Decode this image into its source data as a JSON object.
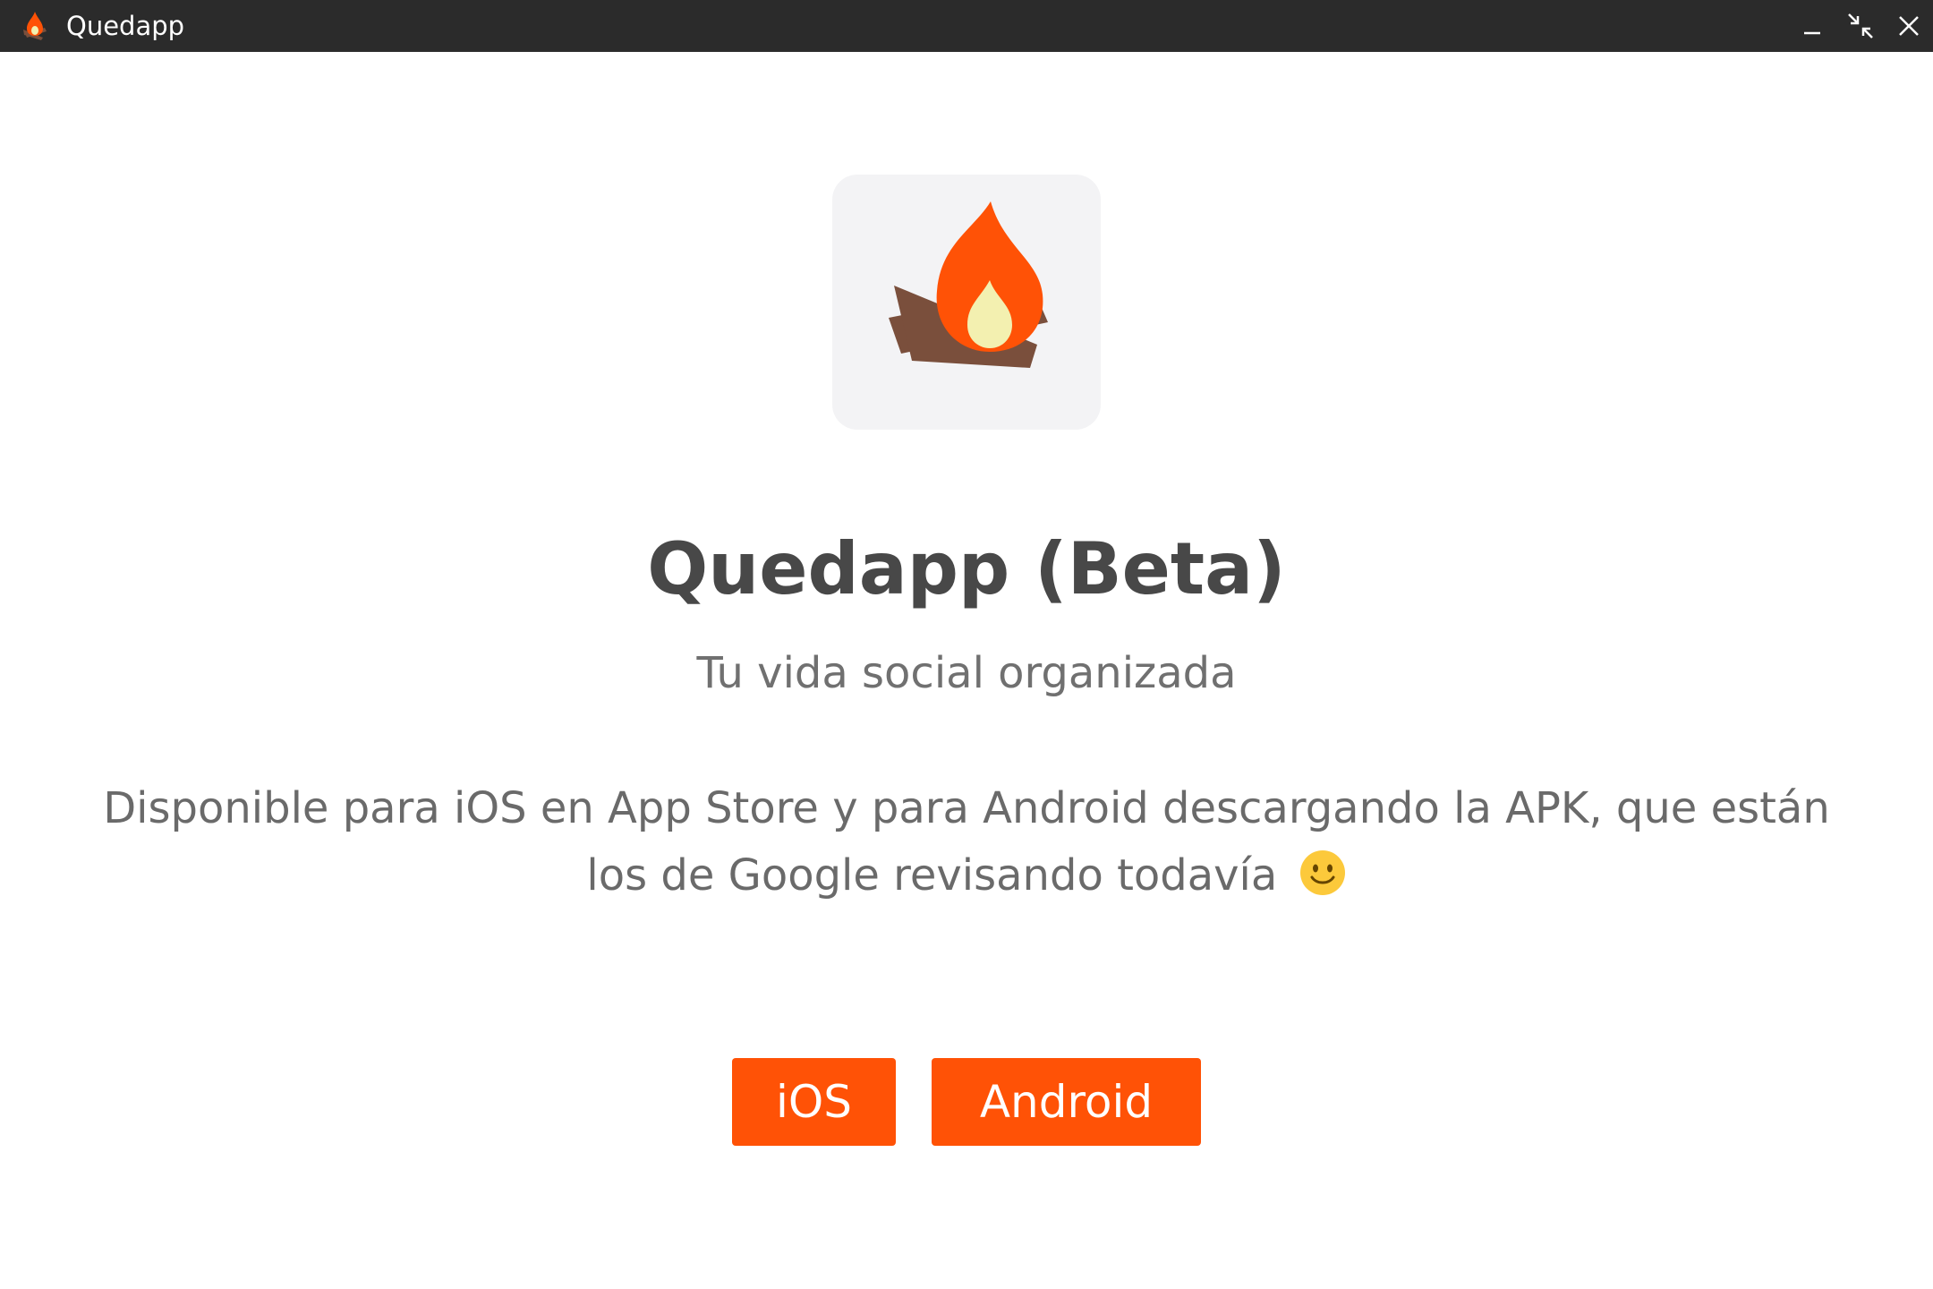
{
  "window": {
    "title": "Quedapp",
    "controls": {
      "minimize_icon": "minimize-icon",
      "restore_icon": "restore-arrows-icon",
      "close_icon": "close-icon"
    }
  },
  "main": {
    "logo_icon": "campfire-icon",
    "heading": "Quedapp (Beta)",
    "subtitle": "Tu vida social organizada",
    "description_line1": "Disponible para iOS en App Store y para Android descargando la APK, que están",
    "description_line2": "los de Google revisando todavía",
    "emoji_icon": "smiling-face-icon",
    "buttons": [
      {
        "label": "iOS"
      },
      {
        "label": "Android"
      }
    ]
  },
  "colors": {
    "titlebar_bg": "#2b2b2b",
    "accent": "#ff5206",
    "heading_text": "#484848",
    "body_text": "#6a6a6a",
    "logo_tile_bg": "#f3f3f5",
    "log_brown": "#7a4f3c",
    "flame_orange": "#ff5206",
    "flame_inner": "#f3f0b0"
  }
}
